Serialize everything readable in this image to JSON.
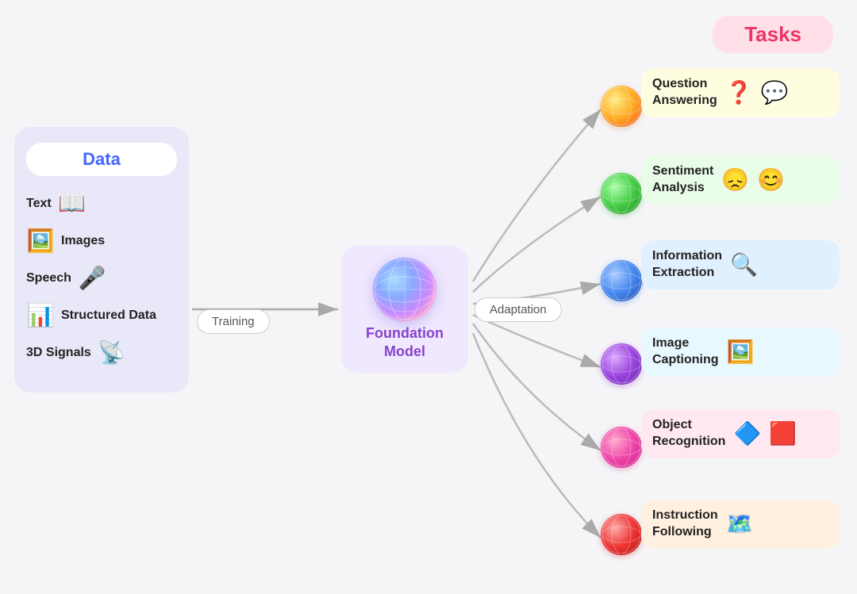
{
  "data_panel": {
    "title": "Data",
    "items": [
      {
        "label": "Text",
        "icon": "📖"
      },
      {
        "label": "Images",
        "icon": "🖼️"
      },
      {
        "label": "Speech",
        "icon": "🎤"
      },
      {
        "label": "Structured Data",
        "icon": "📊"
      },
      {
        "label": "3D Signals",
        "icon": "📡"
      }
    ]
  },
  "foundation_model": {
    "title": "Foundation\nModel",
    "sphere_icon": "🌐"
  },
  "labels": {
    "training": "Training",
    "adaptation": "Adaptation"
  },
  "tasks": {
    "title": "Tasks",
    "items": [
      {
        "label": "Question\nAnswering",
        "bg": "#fffde0",
        "sphere": "🟠",
        "icon": "❓",
        "icon2": "💬"
      },
      {
        "label": "Sentiment\nAnalysis",
        "bg": "#e8fce8",
        "sphere": "🟢",
        "icon": "😊"
      },
      {
        "label": "Information\nExtraction",
        "bg": "#e0f0ff",
        "sphere": "🔵",
        "icon": "🔍"
      },
      {
        "label": "Image\nCaptioning",
        "bg": "#e8f8ff",
        "sphere": "🟣",
        "icon": "🖼️"
      },
      {
        "label": "Object\nRecognition",
        "bg": "#ffe8f0",
        "sphere": "🔴",
        "icon": "🔷"
      },
      {
        "label": "Instruction\nFollowing",
        "bg": "#fff0e0",
        "sphere": "🔴",
        "icon": "🗺️"
      }
    ]
  }
}
